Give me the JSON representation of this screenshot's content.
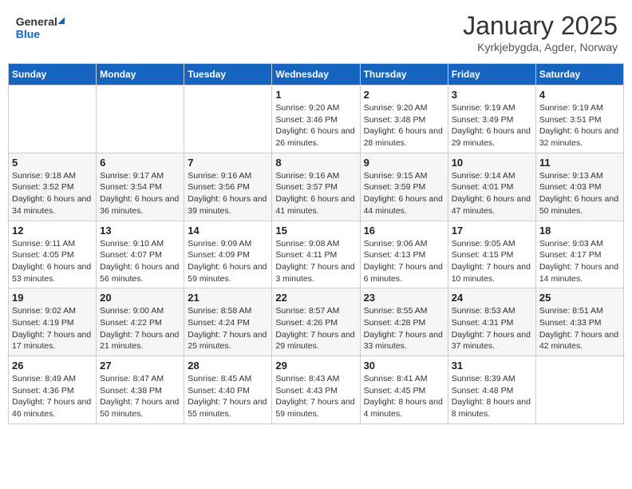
{
  "header": {
    "logo_general": "General",
    "logo_blue": "Blue",
    "month_title": "January 2025",
    "location": "Kyrkjebygda, Agder, Norway"
  },
  "weekdays": [
    "Sunday",
    "Monday",
    "Tuesday",
    "Wednesday",
    "Thursday",
    "Friday",
    "Saturday"
  ],
  "weeks": [
    [
      {
        "day": "",
        "sunrise": "",
        "sunset": "",
        "daylight": ""
      },
      {
        "day": "",
        "sunrise": "",
        "sunset": "",
        "daylight": ""
      },
      {
        "day": "",
        "sunrise": "",
        "sunset": "",
        "daylight": ""
      },
      {
        "day": "1",
        "sunrise": "Sunrise: 9:20 AM",
        "sunset": "Sunset: 3:46 PM",
        "daylight": "Daylight: 6 hours and 26 minutes."
      },
      {
        "day": "2",
        "sunrise": "Sunrise: 9:20 AM",
        "sunset": "Sunset: 3:48 PM",
        "daylight": "Daylight: 6 hours and 28 minutes."
      },
      {
        "day": "3",
        "sunrise": "Sunrise: 9:19 AM",
        "sunset": "Sunset: 3:49 PM",
        "daylight": "Daylight: 6 hours and 29 minutes."
      },
      {
        "day": "4",
        "sunrise": "Sunrise: 9:19 AM",
        "sunset": "Sunset: 3:51 PM",
        "daylight": "Daylight: 6 hours and 32 minutes."
      }
    ],
    [
      {
        "day": "5",
        "sunrise": "Sunrise: 9:18 AM",
        "sunset": "Sunset: 3:52 PM",
        "daylight": "Daylight: 6 hours and 34 minutes."
      },
      {
        "day": "6",
        "sunrise": "Sunrise: 9:17 AM",
        "sunset": "Sunset: 3:54 PM",
        "daylight": "Daylight: 6 hours and 36 minutes."
      },
      {
        "day": "7",
        "sunrise": "Sunrise: 9:16 AM",
        "sunset": "Sunset: 3:56 PM",
        "daylight": "Daylight: 6 hours and 39 minutes."
      },
      {
        "day": "8",
        "sunrise": "Sunrise: 9:16 AM",
        "sunset": "Sunset: 3:57 PM",
        "daylight": "Daylight: 6 hours and 41 minutes."
      },
      {
        "day": "9",
        "sunrise": "Sunrise: 9:15 AM",
        "sunset": "Sunset: 3:59 PM",
        "daylight": "Daylight: 6 hours and 44 minutes."
      },
      {
        "day": "10",
        "sunrise": "Sunrise: 9:14 AM",
        "sunset": "Sunset: 4:01 PM",
        "daylight": "Daylight: 6 hours and 47 minutes."
      },
      {
        "day": "11",
        "sunrise": "Sunrise: 9:13 AM",
        "sunset": "Sunset: 4:03 PM",
        "daylight": "Daylight: 6 hours and 50 minutes."
      }
    ],
    [
      {
        "day": "12",
        "sunrise": "Sunrise: 9:11 AM",
        "sunset": "Sunset: 4:05 PM",
        "daylight": "Daylight: 6 hours and 53 minutes."
      },
      {
        "day": "13",
        "sunrise": "Sunrise: 9:10 AM",
        "sunset": "Sunset: 4:07 PM",
        "daylight": "Daylight: 6 hours and 56 minutes."
      },
      {
        "day": "14",
        "sunrise": "Sunrise: 9:09 AM",
        "sunset": "Sunset: 4:09 PM",
        "daylight": "Daylight: 6 hours and 59 minutes."
      },
      {
        "day": "15",
        "sunrise": "Sunrise: 9:08 AM",
        "sunset": "Sunset: 4:11 PM",
        "daylight": "Daylight: 7 hours and 3 minutes."
      },
      {
        "day": "16",
        "sunrise": "Sunrise: 9:06 AM",
        "sunset": "Sunset: 4:13 PM",
        "daylight": "Daylight: 7 hours and 6 minutes."
      },
      {
        "day": "17",
        "sunrise": "Sunrise: 9:05 AM",
        "sunset": "Sunset: 4:15 PM",
        "daylight": "Daylight: 7 hours and 10 minutes."
      },
      {
        "day": "18",
        "sunrise": "Sunrise: 9:03 AM",
        "sunset": "Sunset: 4:17 PM",
        "daylight": "Daylight: 7 hours and 14 minutes."
      }
    ],
    [
      {
        "day": "19",
        "sunrise": "Sunrise: 9:02 AM",
        "sunset": "Sunset: 4:19 PM",
        "daylight": "Daylight: 7 hours and 17 minutes."
      },
      {
        "day": "20",
        "sunrise": "Sunrise: 9:00 AM",
        "sunset": "Sunset: 4:22 PM",
        "daylight": "Daylight: 7 hours and 21 minutes."
      },
      {
        "day": "21",
        "sunrise": "Sunrise: 8:58 AM",
        "sunset": "Sunset: 4:24 PM",
        "daylight": "Daylight: 7 hours and 25 minutes."
      },
      {
        "day": "22",
        "sunrise": "Sunrise: 8:57 AM",
        "sunset": "Sunset: 4:26 PM",
        "daylight": "Daylight: 7 hours and 29 minutes."
      },
      {
        "day": "23",
        "sunrise": "Sunrise: 8:55 AM",
        "sunset": "Sunset: 4:28 PM",
        "daylight": "Daylight: 7 hours and 33 minutes."
      },
      {
        "day": "24",
        "sunrise": "Sunrise: 8:53 AM",
        "sunset": "Sunset: 4:31 PM",
        "daylight": "Daylight: 7 hours and 37 minutes."
      },
      {
        "day": "25",
        "sunrise": "Sunrise: 8:51 AM",
        "sunset": "Sunset: 4:33 PM",
        "daylight": "Daylight: 7 hours and 42 minutes."
      }
    ],
    [
      {
        "day": "26",
        "sunrise": "Sunrise: 8:49 AM",
        "sunset": "Sunset: 4:36 PM",
        "daylight": "Daylight: 7 hours and 46 minutes."
      },
      {
        "day": "27",
        "sunrise": "Sunrise: 8:47 AM",
        "sunset": "Sunset: 4:38 PM",
        "daylight": "Daylight: 7 hours and 50 minutes."
      },
      {
        "day": "28",
        "sunrise": "Sunrise: 8:45 AM",
        "sunset": "Sunset: 4:40 PM",
        "daylight": "Daylight: 7 hours and 55 minutes."
      },
      {
        "day": "29",
        "sunrise": "Sunrise: 8:43 AM",
        "sunset": "Sunset: 4:43 PM",
        "daylight": "Daylight: 7 hours and 59 minutes."
      },
      {
        "day": "30",
        "sunrise": "Sunrise: 8:41 AM",
        "sunset": "Sunset: 4:45 PM",
        "daylight": "Daylight: 8 hours and 4 minutes."
      },
      {
        "day": "31",
        "sunrise": "Sunrise: 8:39 AM",
        "sunset": "Sunset: 4:48 PM",
        "daylight": "Daylight: 8 hours and 8 minutes."
      },
      {
        "day": "",
        "sunrise": "",
        "sunset": "",
        "daylight": ""
      }
    ]
  ]
}
